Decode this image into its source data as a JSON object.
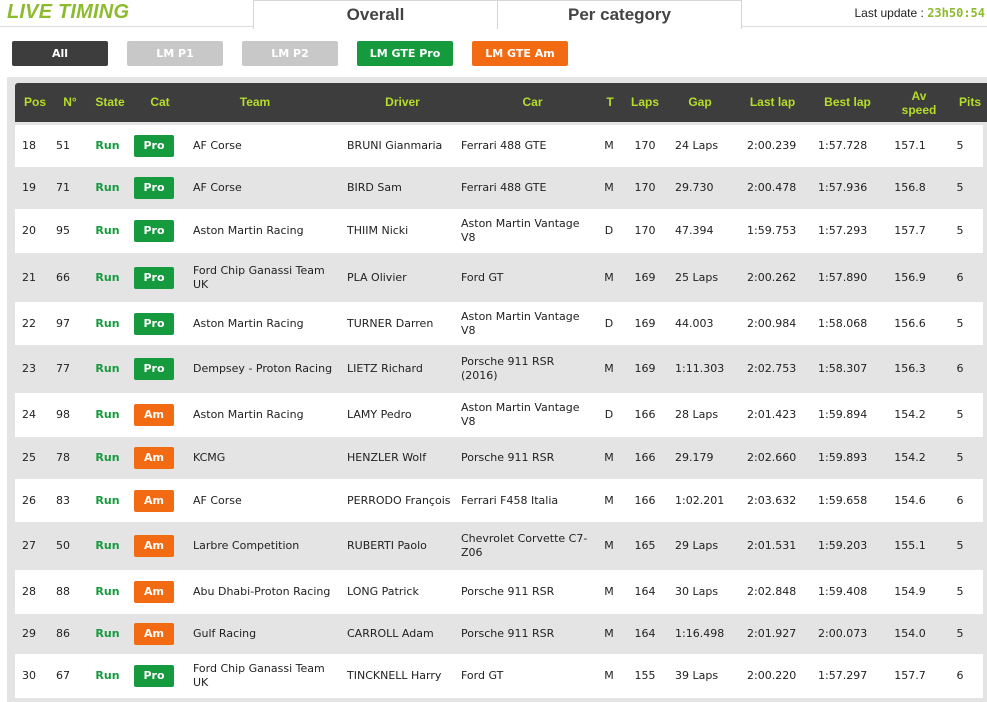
{
  "header": {
    "brand": "LIVE TIMING",
    "tabs": [
      "Overall",
      "Per category"
    ],
    "last_update_label": "Last update : ",
    "last_update_time": "23h50:54"
  },
  "filters": [
    "All",
    "LM P1",
    "LM P2",
    "LM GTE Pro",
    "LM GTE Am"
  ],
  "colors": {
    "accent": "#8dbb2f",
    "header_text": "#b5dd2a",
    "pro": "#169a3e",
    "am": "#f26a12",
    "dark": "#3d3d3d"
  },
  "columns": [
    "Pos",
    "N°",
    "State",
    "Cat",
    "Team",
    "Driver",
    "Car",
    "T",
    "Laps",
    "Gap",
    "Last lap",
    "Best lap",
    "Av speed",
    "Pits"
  ],
  "rows": [
    {
      "pos": "18",
      "num": "51",
      "state": "Run",
      "cat": "Pro",
      "team": "AF Corse",
      "driver": "BRUNI Gianmaria",
      "car": "Ferrari 488 GTE",
      "t": "M",
      "laps": "170",
      "gap": "24 Laps",
      "last": "2:00.239",
      "best": "1:57.728",
      "speed": "157.1",
      "pits": "5"
    },
    {
      "pos": "19",
      "num": "71",
      "state": "Run",
      "cat": "Pro",
      "team": "AF Corse",
      "driver": "BIRD Sam",
      "car": "Ferrari 488 GTE",
      "t": "M",
      "laps": "170",
      "gap": "29.730",
      "last": "2:00.478",
      "best": "1:57.936",
      "speed": "156.8",
      "pits": "5"
    },
    {
      "pos": "20",
      "num": "95",
      "state": "Run",
      "cat": "Pro",
      "team": "Aston Martin Racing",
      "driver": "THIIM Nicki",
      "car": "Aston Martin Vantage V8",
      "t": "D",
      "laps": "170",
      "gap": "47.394",
      "last": "1:59.753",
      "best": "1:57.293",
      "speed": "157.7",
      "pits": "5"
    },
    {
      "pos": "21",
      "num": "66",
      "state": "Run",
      "cat": "Pro",
      "team": "Ford Chip Ganassi Team UK",
      "driver": "PLA Olivier",
      "car": "Ford GT",
      "t": "M",
      "laps": "169",
      "gap": "25 Laps",
      "last": "2:00.262",
      "best": "1:57.890",
      "speed": "156.9",
      "pits": "6"
    },
    {
      "pos": "22",
      "num": "97",
      "state": "Run",
      "cat": "Pro",
      "team": "Aston Martin Racing",
      "driver": "TURNER Darren",
      "car": "Aston Martin Vantage V8",
      "t": "D",
      "laps": "169",
      "gap": "44.003",
      "last": "2:00.984",
      "best": "1:58.068",
      "speed": "156.6",
      "pits": "5"
    },
    {
      "pos": "23",
      "num": "77",
      "state": "Run",
      "cat": "Pro",
      "team": "Dempsey - Proton Racing",
      "driver": "LIETZ Richard",
      "car": "Porsche 911 RSR (2016)",
      "t": "M",
      "laps": "169",
      "gap": "1:11.303",
      "last": "2:02.753",
      "best": "1:58.307",
      "speed": "156.3",
      "pits": "6"
    },
    {
      "pos": "24",
      "num": "98",
      "state": "Run",
      "cat": "Am",
      "team": "Aston Martin Racing",
      "driver": "LAMY Pedro",
      "car": "Aston Martin Vantage V8",
      "t": "D",
      "laps": "166",
      "gap": "28 Laps",
      "last": "2:01.423",
      "best": "1:59.894",
      "speed": "154.2",
      "pits": "5"
    },
    {
      "pos": "25",
      "num": "78",
      "state": "Run",
      "cat": "Am",
      "team": "KCMG",
      "driver": "HENZLER Wolf",
      "car": "Porsche 911 RSR",
      "t": "M",
      "laps": "166",
      "gap": "29.179",
      "last": "2:02.660",
      "best": "1:59.893",
      "speed": "154.2",
      "pits": "5"
    },
    {
      "pos": "26",
      "num": "83",
      "state": "Run",
      "cat": "Am",
      "team": "AF Corse",
      "driver": "PERRODO François",
      "car": "Ferrari F458 Italia",
      "t": "M",
      "laps": "166",
      "gap": "1:02.201",
      "last": "2:03.632",
      "best": "1:59.658",
      "speed": "154.6",
      "pits": "6"
    },
    {
      "pos": "27",
      "num": "50",
      "state": "Run",
      "cat": "Am",
      "team": "Larbre Competition",
      "driver": "RUBERTI Paolo",
      "car": "Chevrolet Corvette C7-Z06",
      "t": "M",
      "laps": "165",
      "gap": "29 Laps",
      "last": "2:01.531",
      "best": "1:59.203",
      "speed": "155.1",
      "pits": "5"
    },
    {
      "pos": "28",
      "num": "88",
      "state": "Run",
      "cat": "Am",
      "team": "Abu Dhabi-Proton Racing",
      "driver": "LONG Patrick",
      "car": "Porsche 911 RSR",
      "t": "M",
      "laps": "164",
      "gap": "30 Laps",
      "last": "2:02.848",
      "best": "1:59.408",
      "speed": "154.9",
      "pits": "5"
    },
    {
      "pos": "29",
      "num": "86",
      "state": "Run",
      "cat": "Am",
      "team": "Gulf Racing",
      "driver": "CARROLL Adam",
      "car": "Porsche 911 RSR",
      "t": "M",
      "laps": "164",
      "gap": "1:16.498",
      "last": "2:01.927",
      "best": "2:00.073",
      "speed": "154.0",
      "pits": "5"
    },
    {
      "pos": "30",
      "num": "67",
      "state": "Run",
      "cat": "Pro",
      "team": "Ford Chip Ganassi Team UK",
      "driver": "TINCKNELL Harry",
      "car": "Ford GT",
      "t": "M",
      "laps": "155",
      "gap": "39 Laps",
      "last": "2:00.220",
      "best": "1:57.297",
      "speed": "157.7",
      "pits": "6"
    }
  ]
}
